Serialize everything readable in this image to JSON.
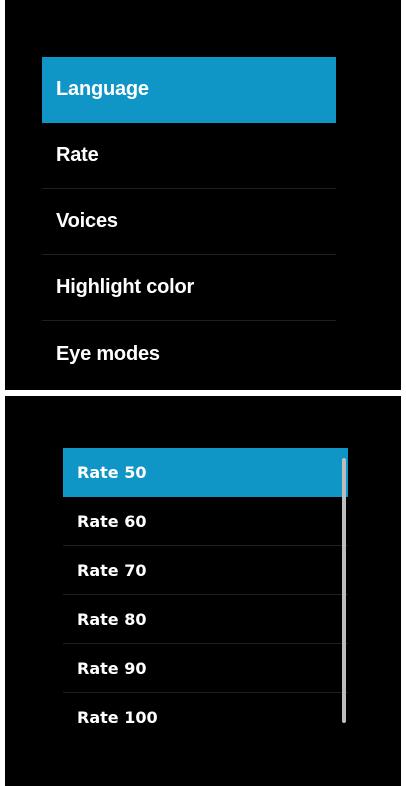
{
  "settings_menu": {
    "items": [
      {
        "label": "Language"
      },
      {
        "label": "Rate"
      },
      {
        "label": "Voices"
      },
      {
        "label": "Highlight color"
      },
      {
        "label": "Eye modes"
      }
    ],
    "selected_index": 0
  },
  "rate_picker": {
    "items": [
      {
        "label": "Rate 50"
      },
      {
        "label": "Rate 60"
      },
      {
        "label": "Rate 70"
      },
      {
        "label": "Rate 80"
      },
      {
        "label": "Rate 90"
      },
      {
        "label": "Rate 100"
      }
    ],
    "selected_index": 0
  },
  "colors": {
    "accent": "#0f95c6",
    "background": "#000000",
    "text": "#ffffff",
    "divider": "#1f1f1f",
    "scrollbar": "#bdbdbd"
  }
}
